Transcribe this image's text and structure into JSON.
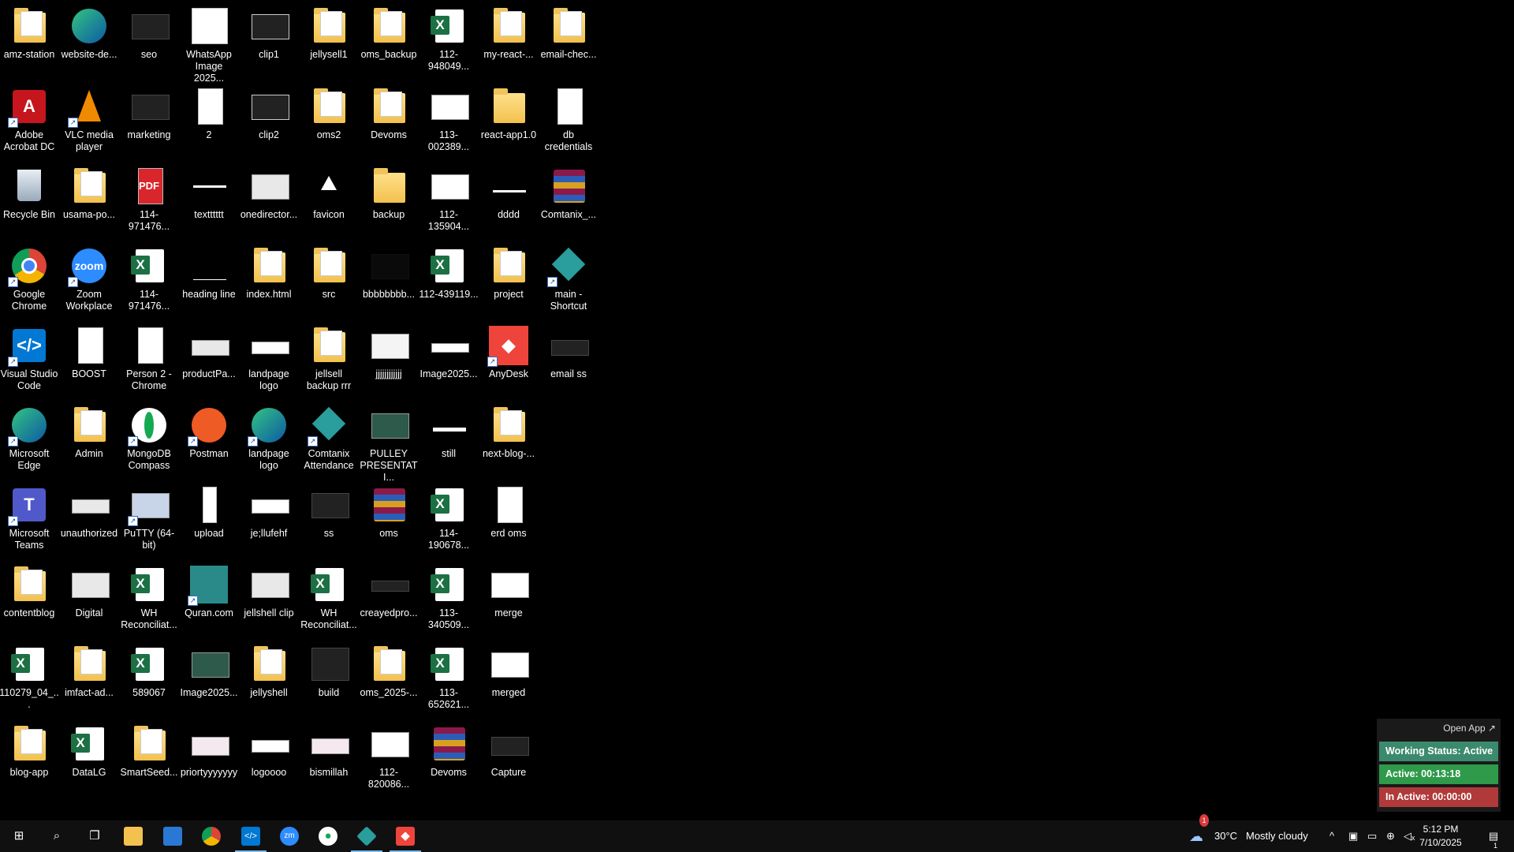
{
  "desktop_icons": {
    "amz_station": "amz-station",
    "website_de": "website-de...",
    "seo": "seo",
    "whatsapp_image": "WhatsApp Image 2025...",
    "clip1": "clip1",
    "jellysell1": "jellysell1",
    "oms_backup": "oms_backup",
    "x112_948049": "112-948049...",
    "my_react": "my-react-...",
    "email_chec": "email-chec...",
    "adobe": "Adobe Acrobat DC",
    "vlc": "VLC media player",
    "marketing": "marketing",
    "two": "2",
    "clip2": "clip2",
    "oms2": "oms2",
    "devoms": "Devoms",
    "x113_002389": "113-002389...",
    "react_app": "react-app1.0",
    "db_credentials": "db credentials",
    "recycle_bin": "Recycle Bin",
    "usama_po": "usama-po...",
    "pdf_114": "114-971476...",
    "textttttt": "textttttt",
    "onedirector": "onedirector...",
    "favicon": "favicon",
    "backup": "backup",
    "x112_135904": "112-135904...",
    "dddd": "dddd",
    "comtanix_rar": "Comtanix_...",
    "google_chrome": "Google Chrome",
    "zoom": "Zoom Workplace",
    "x114_971476": "114-971476...",
    "heading_line": "heading line",
    "index_html": "index.html",
    "src": "src",
    "bbbb": "bbbbbbbb...",
    "x112_439119": "112-439119...",
    "project": "project",
    "main_shortcut": "main - Shortcut",
    "vscode": "Visual Studio Code",
    "boost": "BOOST",
    "person2": "Person 2 - Chrome",
    "productpa": "productPa...",
    "landpage_logo1": "landpage logo",
    "jellsell_backup": "jellsell backup rrr",
    "jjjj": "jjjjjjjjjjjj",
    "image2025_1": "Image2025...",
    "anydesk": "AnyDesk",
    "email_ss": "email ss",
    "ms_edge": "Microsoft Edge",
    "admin": "Admin",
    "mongodb": "MongoDB Compass",
    "postman": "Postman",
    "landpage_logo2": "landpage logo",
    "comtanix_att": "Comtanix Attendance",
    "pulley": "PULLEY PRESENTATI...",
    "still": "still",
    "next_blog": "next-blog-...",
    "ms_teams": "Microsoft Teams",
    "unauthorized": "unauthorized",
    "putty": "PuTTY (64-bit)",
    "upload": "upload",
    "jellufehf": "je;llufehf",
    "ss": "ss",
    "oms": "oms",
    "x114_190678": "114-190678...",
    "erd_oms": "erd oms",
    "contentblog": "contentblog",
    "digital": "Digital",
    "wh_rec1": "WH Reconciliat...",
    "quran": "Quran.com",
    "jellshell_clip": "jellshell clip",
    "wh_rec2": "WH Reconciliat...",
    "creayedpro": "creayedpro...",
    "x113_340509": "113-340509...",
    "merge": "merge",
    "x110279": "110279_04_...",
    "imfact_ad": "imfact-ad...",
    "n589067": "589067",
    "image2025_2": "Image2025...",
    "jellyshell": "jellyshell",
    "build": "build",
    "oms_2025": "oms_2025-...",
    "x113_652621": "113-652621...",
    "merged": "merged",
    "blog_app": "blog-app",
    "datalg": "DataLG",
    "smartseed": "SmartSeed...",
    "priorty": "priortyyyyyyy",
    "logoooo": "logoooo",
    "bismillah": "bismillah",
    "x112_820086": "112-820086...",
    "devoms_rar": "Devoms",
    "capture": "Capture"
  },
  "tracker": {
    "open_app": "Open App ↗",
    "working_status": "Working Status: Active",
    "active": "Active: 00:13:18",
    "inactive": "In Active: 00:00:00",
    "colors": {
      "status": "#3c8a6e",
      "active": "#2e9a4a",
      "inactive": "#b03a3a"
    }
  },
  "taskbar": {
    "weather_temp": "30°C",
    "weather_desc": "Mostly cloudy",
    "time": "5:12 PM",
    "date": "7/10/2025",
    "notification_count": "1",
    "weather_alert": "1"
  }
}
